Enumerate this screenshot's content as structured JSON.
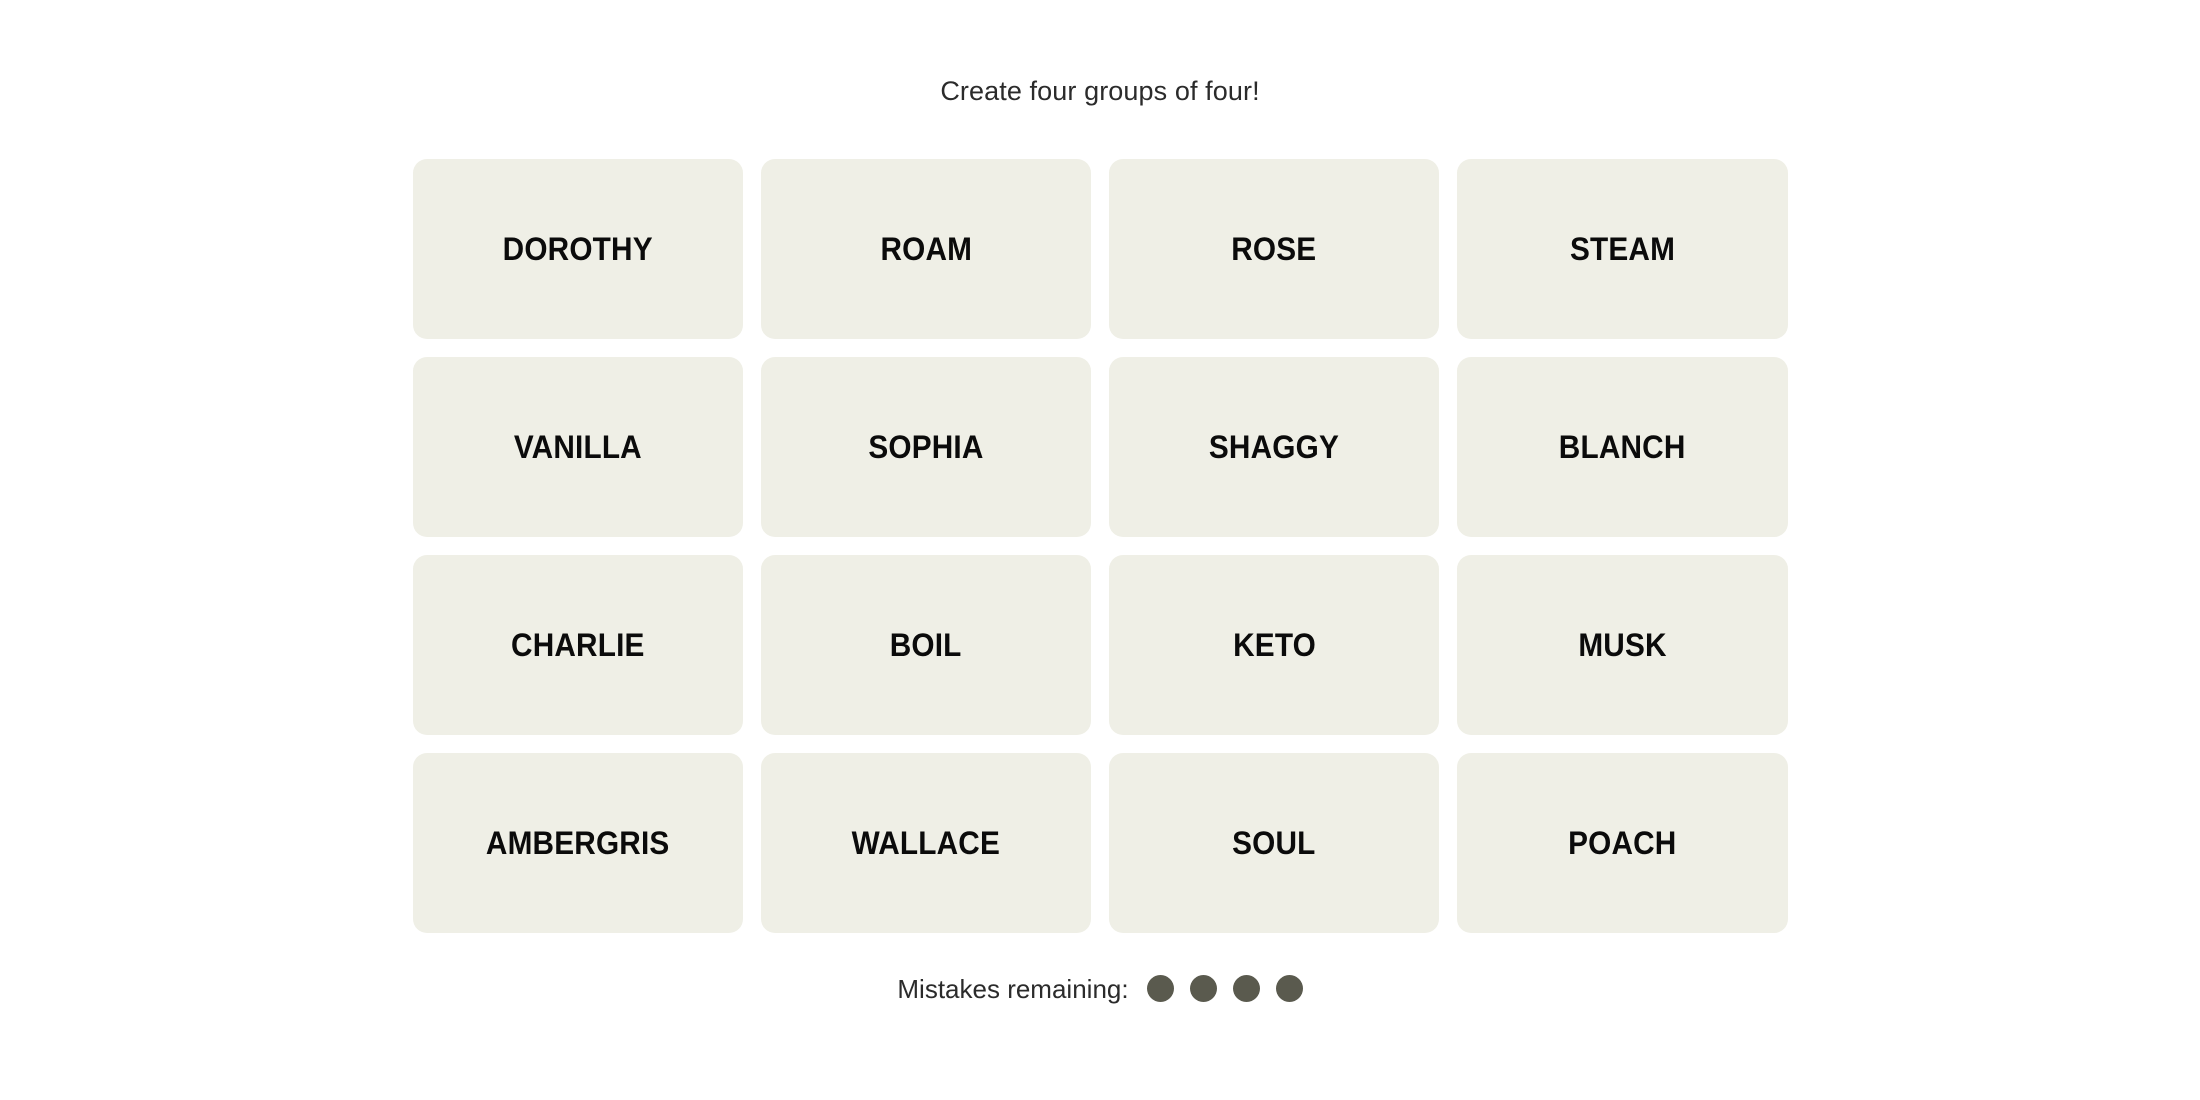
{
  "header": {
    "instruction": "Create four groups of four!"
  },
  "board": {
    "rows": 4,
    "columns": 4,
    "tile_background": "#EFEFE6",
    "tile_text_color": "#0B0B0B",
    "tiles": [
      {
        "word": "DOROTHY"
      },
      {
        "word": "ROAM"
      },
      {
        "word": "ROSE"
      },
      {
        "word": "STEAM"
      },
      {
        "word": "VANILLA"
      },
      {
        "word": "SOPHIA"
      },
      {
        "word": "SHAGGY"
      },
      {
        "word": "BLANCH"
      },
      {
        "word": "CHARLIE"
      },
      {
        "word": "BOIL"
      },
      {
        "word": "KETO"
      },
      {
        "word": "MUSK"
      },
      {
        "word": "AMBERGRIS"
      },
      {
        "word": "WALLACE"
      },
      {
        "word": "SOUL"
      },
      {
        "word": "POACH"
      }
    ]
  },
  "footer": {
    "mistakes_label": "Mistakes remaining:",
    "mistakes_remaining": 4,
    "dot_color": "#5A5A4E",
    "dots": [
      {
        "state": "remaining"
      },
      {
        "state": "remaining"
      },
      {
        "state": "remaining"
      },
      {
        "state": "remaining"
      }
    ]
  }
}
